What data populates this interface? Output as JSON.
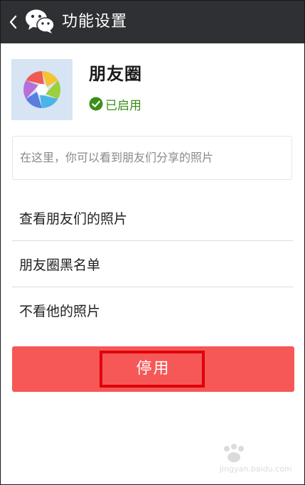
{
  "header": {
    "back_icon": "chevron-left-icon",
    "logo_icon": "wechat-icon",
    "title": "功能设置",
    "bg_color": "#2e3033"
  },
  "app": {
    "icon": "aperture-icon",
    "name": "朋友圈",
    "status_icon": "check-circle-icon",
    "status": "已启用",
    "status_color": "#3a8f18"
  },
  "description": "在这里，你可以看到朋友们分享的照片",
  "menu": [
    {
      "label": "查看朋友们的照片"
    },
    {
      "label": "朋友圈黑名单"
    },
    {
      "label": "不看他的照片"
    }
  ],
  "disable_button": {
    "label": "停用",
    "color": "#f65858",
    "highlight_color": "#e0000a"
  },
  "watermark": {
    "text": "jingyan.baidu.com"
  }
}
